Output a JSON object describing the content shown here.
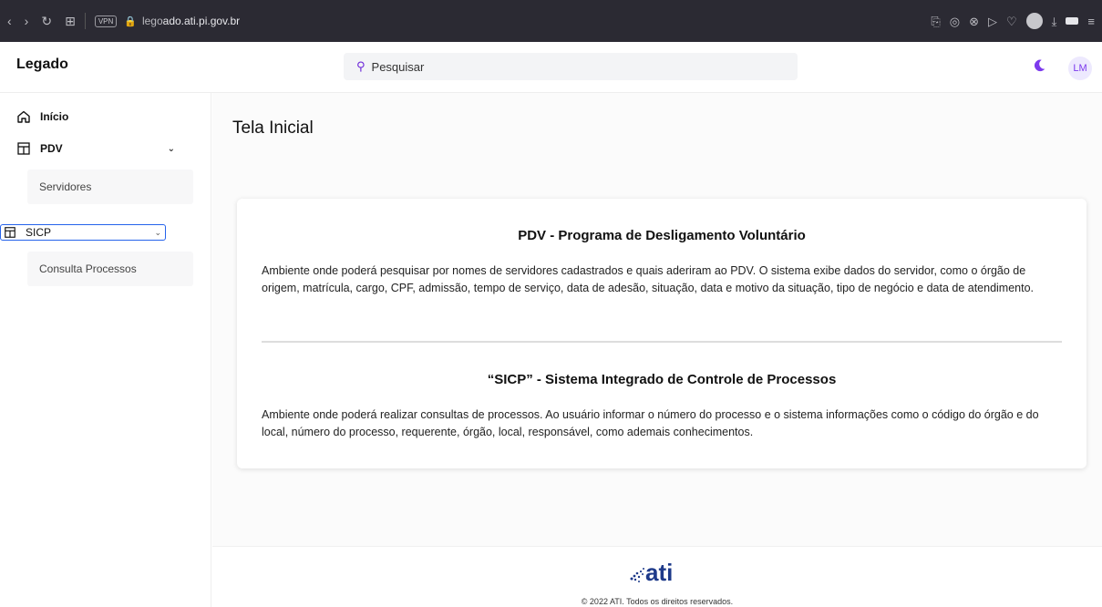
{
  "browser": {
    "url_prefix": "lego",
    "url_domain": "ado.ati.pi.gov.br",
    "vpn_label": "VPN"
  },
  "header": {
    "app_name": "Legado",
    "search_placeholder": "Pesquisar",
    "avatar_initials": "LM",
    "accent_color": "#7c3aed"
  },
  "sidebar": {
    "items": [
      {
        "label": "Início",
        "icon": "home-icon"
      },
      {
        "label": "PDV",
        "icon": "table-icon",
        "expanded": true,
        "children": [
          "Servidores"
        ]
      },
      {
        "label": "SICP",
        "icon": "table-icon",
        "expanded": true,
        "children": [
          "Consulta Processos"
        ]
      }
    ]
  },
  "main": {
    "title": "Tela Inicial",
    "sections": [
      {
        "heading": "PDV - Programa de Desligamento Voluntário",
        "text": "Ambiente onde poderá pesquisar por nomes de servidores cadastrados e quais aderiram ao PDV. O sistema exibe dados do servidor, como o órgão de origem, matrícula, cargo, CPF, admissão, tempo de serviço, data de adesão, situação, data e motivo da situação, tipo de negócio e data de atendimento."
      },
      {
        "heading": "“SICP” - Sistema Integrado de Controle de Processos",
        "text": "Ambiente onde poderá realizar consultas de processos. Ao usuário informar o número do processo e o sistema informações como o código do órgão e do local, número do processo, requerente, órgão, local, responsável, como ademais conhecimentos."
      }
    ]
  },
  "footer": {
    "logo_text": "ati",
    "copyright": "© 2022 ATI. Todos os direitos reservados."
  }
}
